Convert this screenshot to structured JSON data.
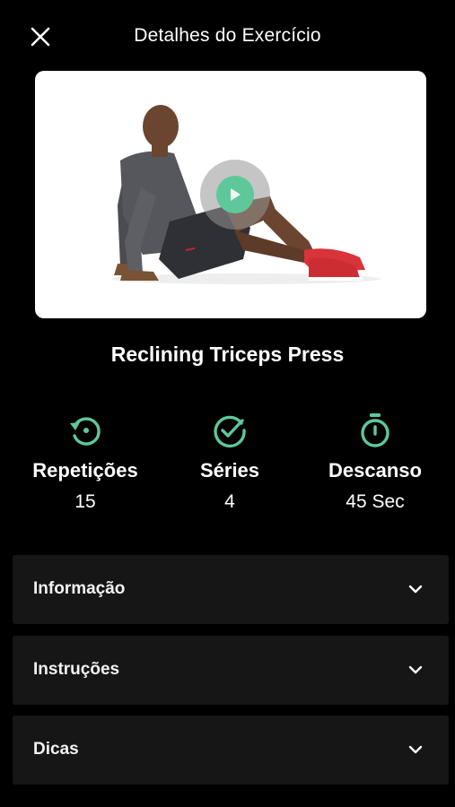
{
  "header": {
    "title": "Detalhes do Exercício",
    "close_icon": "close-icon"
  },
  "media": {
    "type": "exercise-video-thumbnail",
    "play_icon": "play-icon"
  },
  "exercise": {
    "name": "Reclining Triceps Press"
  },
  "stats": [
    {
      "label": "Repetições",
      "value": "15",
      "icon": "repeat-icon"
    },
    {
      "label": "Séries",
      "value": "4",
      "icon": "check-circle-icon"
    },
    {
      "label": "Descanso",
      "value": "45 Sec",
      "icon": "stopwatch-icon"
    }
  ],
  "sections": [
    {
      "label": "Informação",
      "icon": "chevron-down-icon"
    },
    {
      "label": "Instruções",
      "icon": "chevron-down-icon"
    },
    {
      "label": "Dicas",
      "icon": "chevron-down-icon"
    }
  ],
  "colors": {
    "background": "#000000",
    "accent": "#5ec89b",
    "panel": "#161616",
    "text": "#ffffff"
  }
}
